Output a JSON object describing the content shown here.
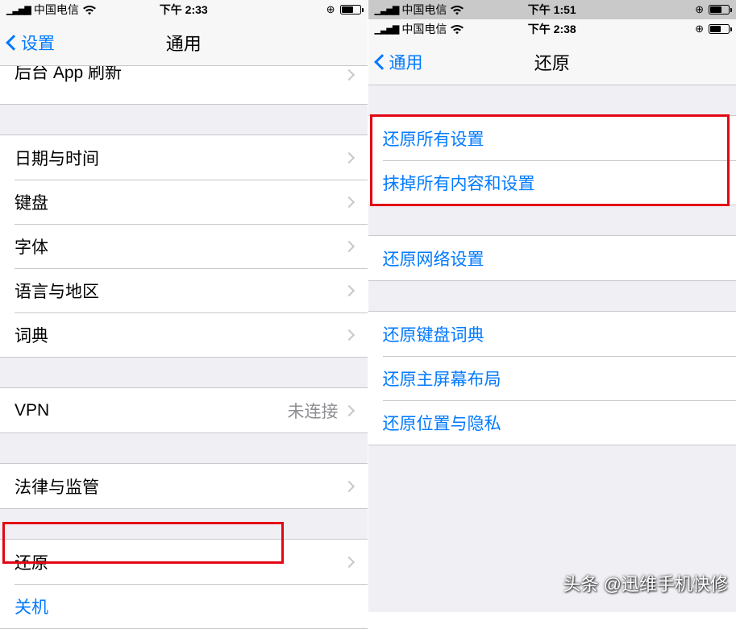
{
  "left": {
    "status": {
      "carrier": "中国电信",
      "time": "下午 2:33",
      "batteryPct": 60
    },
    "nav": {
      "back": "设置",
      "title": "通用"
    },
    "partialRow": "后台 App 刷新",
    "group1": [
      "日期与时间",
      "键盘",
      "字体",
      "语言与地区",
      "词典"
    ],
    "vpn": {
      "label": "VPN",
      "value": "未连接"
    },
    "legal": "法律与监管",
    "reset": "还原",
    "shutdown": "关机"
  },
  "right": {
    "statusTop": {
      "carrier": "中国电信",
      "time": "下午 1:51",
      "batteryPct": 60
    },
    "status": {
      "carrier": "中国电信",
      "time": "下午 2:38",
      "batteryPct": 55
    },
    "nav": {
      "back": "通用",
      "title": "还原"
    },
    "group1": [
      "还原所有设置",
      "抹掉所有内容和设置"
    ],
    "group2": [
      "还原网络设置"
    ],
    "group3": [
      "还原键盘词典",
      "还原主屏幕布局",
      "还原位置与隐私"
    ]
  },
  "watermark": "头条 @迅维手机快修"
}
